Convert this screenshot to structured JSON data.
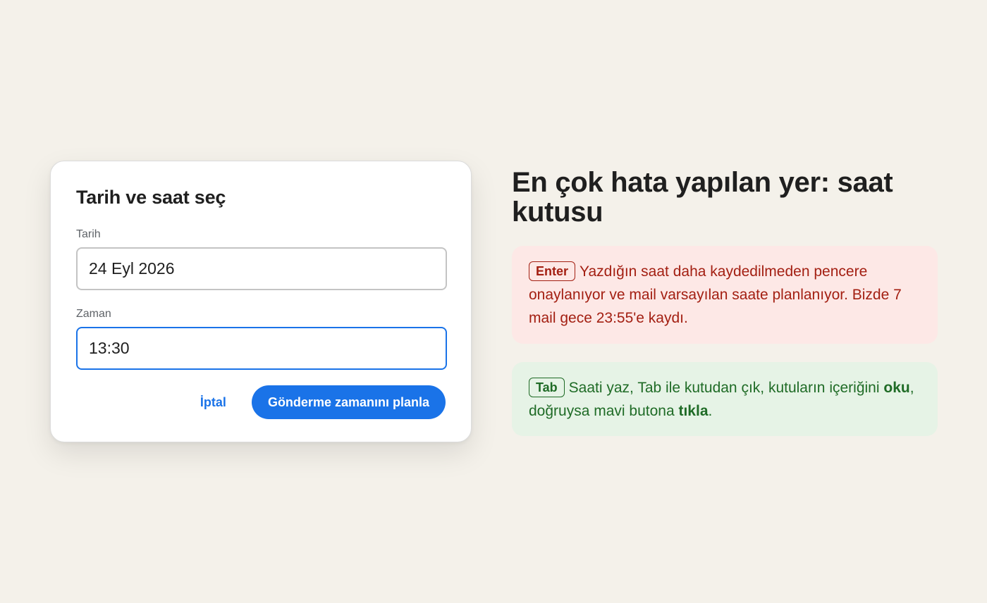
{
  "dialog": {
    "title": "Tarih ve saat seç",
    "date_label": "Tarih",
    "date_value": "24 Eyl 2026",
    "time_label": "Zaman",
    "time_value": "13:30",
    "cancel_label": "İptal",
    "schedule_label": "Gönderme zamanını planla"
  },
  "info": {
    "title": "En çok hata yapılan yer: saat kutusu",
    "bad_note": {
      "key": "Enter",
      "text": "Yazdığın saat daha kaydedilmeden pencere onaylanıyor ve mail varsayılan saate planlanıyor. Bizde 7 mail gece 23:55'e kaydı."
    },
    "good_note": {
      "key": "Tab",
      "text_1": "Saati yaz, Tab ile kutudan çık, kutuların içeriğini",
      "bold_1": "oku",
      "text_2": ", doğruysa mavi butona",
      "bold_2": "tıkla",
      "text_3": "."
    }
  },
  "colors": {
    "background": "#f4f1ea",
    "accent": "#1a73e8",
    "error_bg": "#fde8e6",
    "error_text": "#a31f12",
    "success_bg": "#e6f3e6",
    "success_text": "#1f6b26"
  }
}
